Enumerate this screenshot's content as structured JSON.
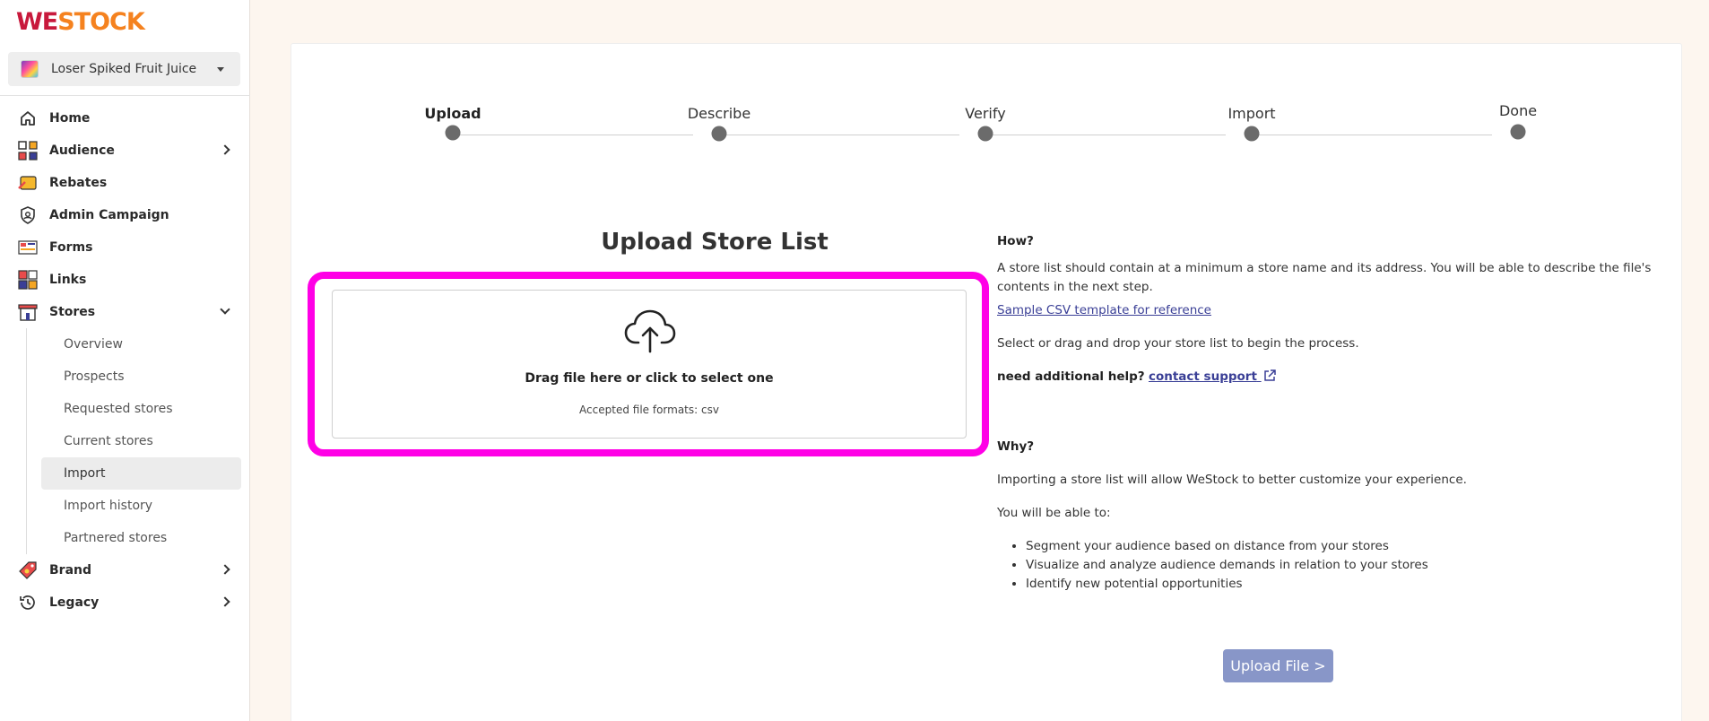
{
  "logo": {
    "part1": "WE",
    "part2": "STOCK"
  },
  "store_selector": {
    "selected": "Loser Spiked Fruit Juice"
  },
  "sidebar": {
    "items": [
      {
        "label": "Home"
      },
      {
        "label": "Audience"
      },
      {
        "label": "Rebates"
      },
      {
        "label": "Admin Campaign"
      },
      {
        "label": "Forms"
      },
      {
        "label": "Links"
      },
      {
        "label": "Stores"
      },
      {
        "label": "Brand"
      },
      {
        "label": "Legacy"
      }
    ],
    "stores_sub": [
      {
        "label": "Overview"
      },
      {
        "label": "Prospects"
      },
      {
        "label": "Requested stores"
      },
      {
        "label": "Current stores"
      },
      {
        "label": "Import"
      },
      {
        "label": "Import history"
      },
      {
        "label": "Partnered stores"
      }
    ]
  },
  "stepper": {
    "steps": [
      "Upload",
      "Describe",
      "Verify",
      "Import",
      "Done"
    ],
    "current": "Upload"
  },
  "upload": {
    "title": "Upload Store List",
    "drop_text": "Drag file here or click to select one",
    "formats": "Accepted file formats: csv"
  },
  "info": {
    "how_heading": "How?",
    "how_text": "A store list should contain at a minimum a store name and its address. You will be able to describe the file's contents in the next step.",
    "sample_link": "Sample CSV template for reference",
    "select_text": "Select or drag and drop your store list to begin the process.",
    "help_prefix": "need additional help?",
    "support_link": "contact support",
    "why_heading": "Why?",
    "why_text": "Importing a store list will allow WeStock to better customize your experience.",
    "able_text": "You will be able to:",
    "bullets": [
      "Segment your audience based on distance from your stores",
      "Visualize and analyze audience demands in relation to your stores",
      "Identify new potential opportunities"
    ]
  },
  "button": {
    "upload_label": "Upload File >"
  },
  "colors": {
    "highlight": "#ff00e6",
    "button": "#8896c8",
    "link": "#3a3f96",
    "brand_red": "#c8193c",
    "brand_orange": "#f5821f"
  }
}
